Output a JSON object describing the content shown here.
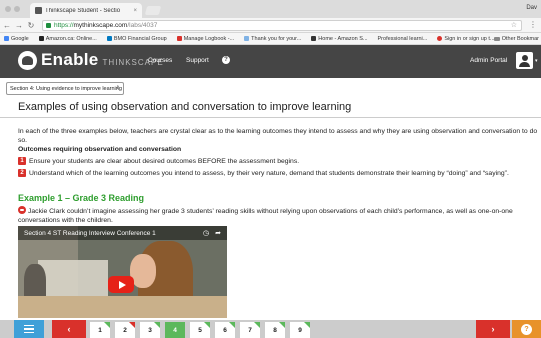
{
  "browser": {
    "tab_title": "Thinkscape Student - Sectio",
    "tab_close": "×",
    "corner_text": "Dav",
    "url_https": "https://",
    "url_host": "mythinkscape.com",
    "url_path": "/labs/4037",
    "bookmarks": [
      {
        "label": "Google",
        "color": "#4285f4"
      },
      {
        "label": "Amazon.ca: Online...",
        "color": "#222222"
      },
      {
        "label": "BMO Financial Group",
        "color": "#0079c1"
      },
      {
        "label": "Manage Logbook -...",
        "color": "#d9312b"
      },
      {
        "label": "Thank you for your...",
        "color": "#7fb2e5"
      },
      {
        "label": "Home - Amazon S...",
        "color": "#333333"
      },
      {
        "label": "Professional learni...",
        "color": "#ffffff"
      },
      {
        "label": "Sign in or sign up t...",
        "color": "#d9312b"
      }
    ],
    "other_bookmarks": "Other Bookmar"
  },
  "header": {
    "logo_main": "Enable",
    "logo_sub": "THINKSCAPE",
    "nav": [
      "Courses",
      "Support"
    ],
    "help_glyph": "?",
    "admin_portal": "Admin Portal",
    "user_caret": "▾"
  },
  "section_select": {
    "value": "Section 4: Using evidence to improve learning",
    "arrows": "⇕"
  },
  "content": {
    "title": "Examples of using observation and conversation to improve learning",
    "intro": "In each of the three examples below, teachers are crystal clear as to the learning outcomes they intend to assess and why they are using observation and conversation to do so.",
    "outcomes_heading": "Outcomes requiring observation and conversation",
    "outcomes": [
      {
        "num": "1",
        "text": "Ensure your students are clear about desired outcomes BEFORE the assessment begins."
      },
      {
        "num": "2",
        "text": "Understand which of the learning outcomes you intend to assess, by their very nature, demand that students demonstrate their learning by “doing” and “saying”."
      }
    ],
    "example_heading": "Example 1 – Grade 3 Reading",
    "example_text": "Jackie Clark couldn’t imagine assessing her grade 3 students’ reading skills without relying upon observations of each child’s performance, as well as one-on-one conversations with the children."
  },
  "video": {
    "title": "Section 4 ST Reading Interview Conference 1"
  },
  "bottom_nav": {
    "prev_glyph": "‹",
    "next_glyph": "›",
    "help_glyph": "?",
    "pages": [
      "1",
      "2",
      "3",
      "4",
      "5",
      "6",
      "7",
      "8",
      "9"
    ],
    "active_page": "4"
  }
}
